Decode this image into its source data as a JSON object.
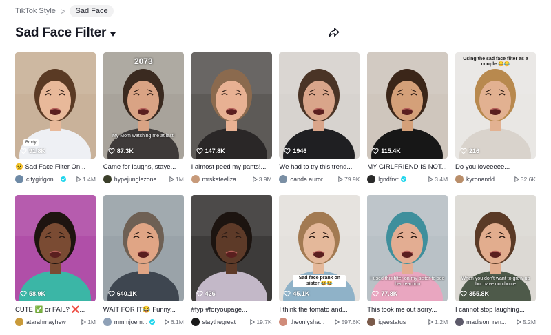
{
  "breadcrumb": {
    "parent": "TikTok Style",
    "separator": ">",
    "current": "Sad Face"
  },
  "header": {
    "title": "Sad Face Filter",
    "caret_icon": "chevron-down-icon",
    "share_icon": "share-icon"
  },
  "videos": [
    {
      "likes": "91.8K",
      "description": "😟 Sad Face Filter On...",
      "author": "citygirlgon...",
      "verified": true,
      "plays": "1.4M",
      "overlay": "Brody",
      "overlay_style": "tag",
      "bg": "#c9b29a",
      "skin": "#e8b99a",
      "hair": "#5a3a24",
      "shirt": "#eef0f4",
      "avatar": "#6e8aa6"
    },
    {
      "likes": "87.3K",
      "description": "Came for laughs, staye...",
      "author": "hypejunglezone",
      "verified": false,
      "plays": "1M",
      "overlay": "2073",
      "overlay2": "My Mom watching me at last!",
      "overlay_style": "big",
      "bg": "#a8a39b",
      "skin": "#d9a384",
      "hair": "#3a2a20",
      "shirt": "#3e3a39",
      "avatar": "#3b3f2a"
    },
    {
      "likes": "147.8K",
      "description": "I almost peed my pants!...",
      "author": "mrskateeliza...",
      "verified": false,
      "plays": "3.9M",
      "overlay": "",
      "overlay_style": "",
      "bg": "#5d5a57",
      "skin": "#e8b193",
      "hair": "#8b6a4e",
      "shirt": "#2a2727",
      "avatar": "#c79a7a"
    },
    {
      "likes": "1946",
      "description": "We had to try this trend...",
      "author": "oanda.auror...",
      "verified": false,
      "plays": "79.9K",
      "overlay": "",
      "overlay_style": "",
      "bg": "#d7d3cf",
      "skin": "#d9a58a",
      "hair": "#4a3426",
      "shirt": "#1f1f22",
      "avatar": "#7a8fa4"
    },
    {
      "likes": "115.4K",
      "description": "MY GIRLFRIEND IS NOT...",
      "author": "lgndfrvr",
      "verified": true,
      "plays": "3.4M",
      "overlay": "",
      "overlay_style": "",
      "bg": "#cfc6bd",
      "skin": "#d4a079",
      "hair": "#3b2619",
      "shirt": "#171717",
      "avatar": "#2a2a2a"
    },
    {
      "likes": "216",
      "description": "Do you loveeeee...",
      "author": "kyronandd...",
      "verified": false,
      "plays": "32.6K",
      "overlay": "Using the sad face filter as a couple 😂😂",
      "overlay_style": "top",
      "bg": "#e9e7e4",
      "skin": "#e2b191",
      "hair": "#b8894e",
      "shirt": "#d9d3cc",
      "avatar": "#b98e6a"
    },
    {
      "likes": "58.9K",
      "description": "CUTE ✅ or FAIL? ❌...",
      "author": "atarahmayhew",
      "verified": false,
      "plays": "1M",
      "overlay": "",
      "overlay_style": "",
      "bg": "#b04fa8",
      "skin": "#7a4b33",
      "hair": "#1e1410",
      "shirt": "#3bb6a6",
      "avatar": "#c99a3a"
    },
    {
      "likes": "640.1K",
      "description": "WAIT FOR IT😂 Funny...",
      "author": "mmmjoem...",
      "verified": true,
      "plays": "6.1M",
      "overlay": "",
      "overlay_style": "",
      "bg": "#9aa3a9",
      "skin": "#e0a585",
      "hair": "#6e6054",
      "shirt": "#3e4650",
      "avatar": "#8fa1b7"
    },
    {
      "likes": "426",
      "description": "#fyp #foryoupage...",
      "author": "staythegreat",
      "verified": false,
      "plays": "19.7K",
      "overlay": "",
      "overlay_style": "",
      "bg": "#3d3b3a",
      "skin": "#5d3a28",
      "hair": "#1c1410",
      "shirt": "#c3b8c8",
      "avatar": "#1a1a1a"
    },
    {
      "likes": "45.1K",
      "description": "I think the tomato and...",
      "author": "theonlysha...",
      "verified": false,
      "plays": "597.6K",
      "overlay": "Sad face prank on sister 😂😂",
      "overlay_style": "pill",
      "bg": "#e4e1dd",
      "skin": "#e4b89a",
      "hair": "#a27a52",
      "shirt": "#8fb2c8",
      "avatar": "#d08c7a"
    },
    {
      "likes": "77.8K",
      "description": "This took me out sorry...",
      "author": "igeestatus",
      "verified": false,
      "plays": "1.2M",
      "overlay": "I used this filter on my sister to see her reaction",
      "overlay_style": "low",
      "bg": "#b9c1c6",
      "skin": "#e3ad92",
      "hair": "#3f8f9c",
      "shirt": "#e9a6c0",
      "avatar": "#7a5a4a"
    },
    {
      "likes": "355.8K",
      "description": "I cannot stop laughing...",
      "author": "madison_ren...",
      "verified": false,
      "plays": "5.2M",
      "overlay": "When you don't want to grow up but have no choice",
      "overlay_style": "low",
      "bg": "#dcd9d4",
      "skin": "#e2ad8e",
      "hair": "#5a3a26",
      "shirt": "#4e5a4a",
      "avatar": "#5d5a6a"
    }
  ]
}
